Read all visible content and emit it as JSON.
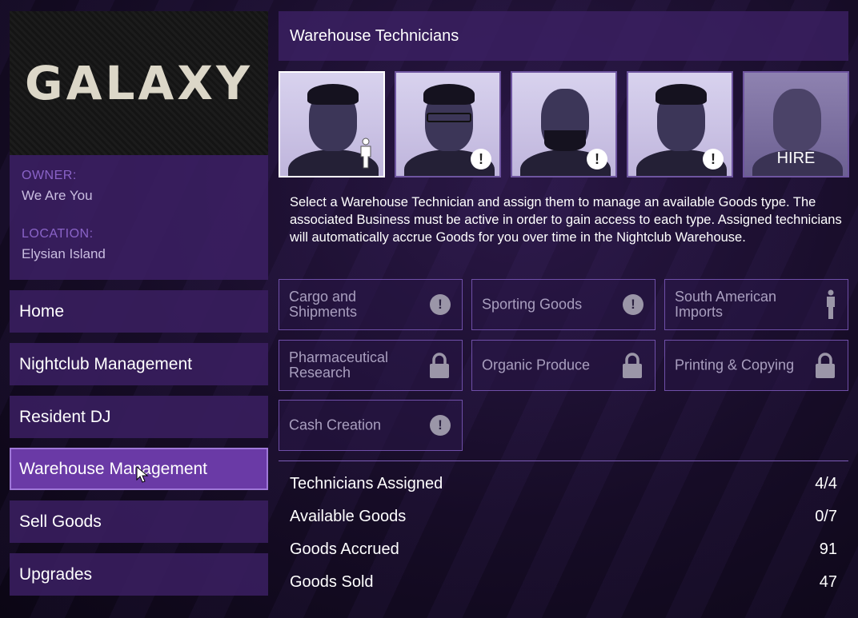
{
  "sidebar": {
    "logo": "GALAXY",
    "owner_label": "OWNER:",
    "owner_value": "We Are You",
    "location_label": "LOCATION:",
    "location_value": "Elysian Island",
    "nav": [
      {
        "label": "Home"
      },
      {
        "label": "Nightclub Management"
      },
      {
        "label": "Resident DJ"
      },
      {
        "label": "Warehouse Management",
        "active": true
      },
      {
        "label": "Sell Goods"
      },
      {
        "label": "Upgrades"
      }
    ]
  },
  "main": {
    "title": "Warehouse Technicians",
    "technicians": [
      {
        "status": "assigned-person-icon"
      },
      {
        "status": "warning-icon",
        "glyph": "!"
      },
      {
        "status": "warning-icon",
        "glyph": "!"
      },
      {
        "status": "warning-icon",
        "glyph": "!"
      },
      {
        "status": "hire",
        "label": "HIRE"
      }
    ],
    "description": "Select a Warehouse Technician and assign them to manage an available Goods type. The associated Business must be active in order to gain access to each type. Assigned technicians will automatically accrue Goods for you over time in the Nightclub Warehouse.",
    "goods": [
      {
        "label": "Cargo and Shipments",
        "icon": "warning-icon",
        "glyph": "!"
      },
      {
        "label": "Sporting Goods",
        "icon": "warning-icon",
        "glyph": "!"
      },
      {
        "label": "South American Imports",
        "icon": "person-icon"
      },
      {
        "label": "Pharmaceutical Research",
        "icon": "lock-icon"
      },
      {
        "label": "Organic Produce",
        "icon": "lock-icon"
      },
      {
        "label": "Printing & Copying",
        "icon": "lock-icon"
      },
      {
        "label": "Cash Creation",
        "icon": "warning-icon",
        "glyph": "!"
      }
    ],
    "stats": [
      {
        "label": "Technicians Assigned",
        "value": "4/4"
      },
      {
        "label": "Available Goods",
        "value": "0/7"
      },
      {
        "label": "Goods Accrued",
        "value": "91"
      },
      {
        "label": "Goods Sold",
        "value": "47"
      }
    ]
  },
  "colors": {
    "accent": "#6a3aa6",
    "panel": "#3c2064",
    "label_purple": "#8a63c8"
  }
}
